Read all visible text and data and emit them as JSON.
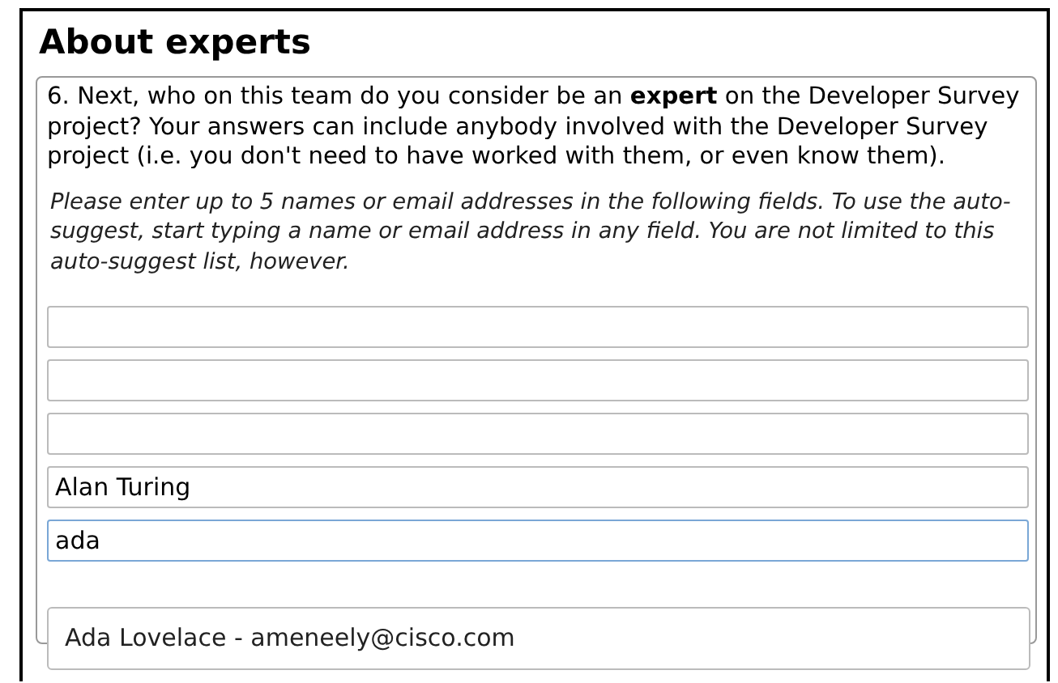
{
  "heading": "About experts",
  "question": "6. Next, who on this team do you consider be an **expert** on the Developer Survey project? Your answers can include anybody involved with the Developer Survey project (i.e. you don't need to have worked with them, or even know them).",
  "instructions": "Please enter up to 5 names or email addresses in the following fields. To use the auto-suggest, start typing a name or email address in any field. You are not limited to this auto-suggest list, however.",
  "fields": [
    {
      "focused": false
    },
    {
      "focused": false
    },
    {
      "focused": false
    },
    {
      "value": "Alan Turing",
      "focused": false
    },
    {
      "value": "ada",
      "focused": true
    }
  ],
  "suggestions": [
    {
      "label": "Ada Lovelace - ameneely@cisco.com"
    }
  ]
}
